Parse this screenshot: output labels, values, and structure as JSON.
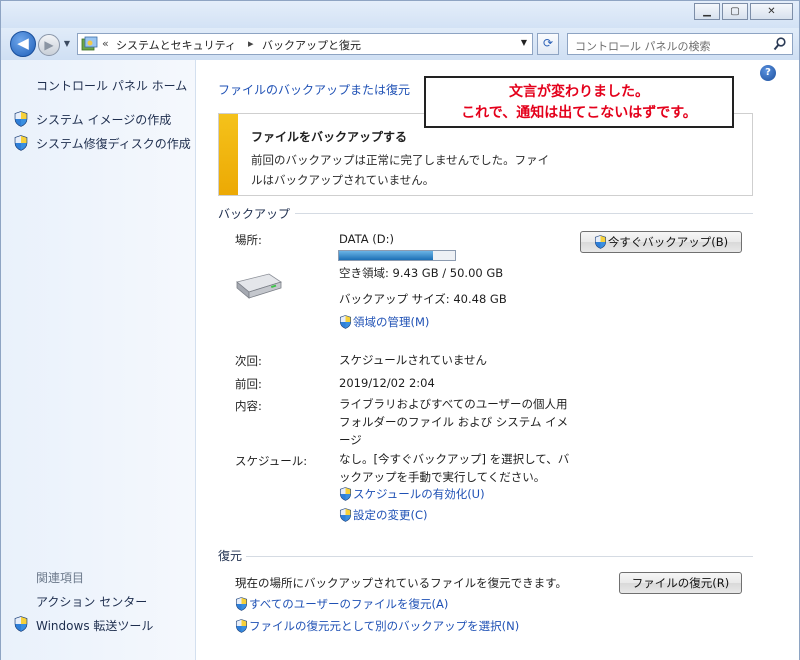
{
  "window": {
    "minimize_glyph": "▁",
    "maximize_glyph": "▢",
    "close_glyph": "✕"
  },
  "nav": {
    "back_glyph": "◀",
    "forward_glyph": "▶",
    "history_glyph": "▼",
    "breadcrumb_prefix": "«",
    "breadcrumb": [
      "システムとセキュリティ",
      "バックアップと復元"
    ],
    "breadcrumb_separator": "▸",
    "address_dropdown_glyph": "▼",
    "refresh_glyph": "⟳",
    "search_placeholder": "コントロール パネルの検索"
  },
  "sidebar": {
    "home": "コントロール パネル ホーム",
    "tasks": [
      "システム イメージの作成",
      "システム修復ディスクの作成"
    ],
    "related_heading": "関連項目",
    "related": [
      "アクション センター",
      "Windows 転送ツール"
    ]
  },
  "main": {
    "help_glyph": "?",
    "title": "ファイルのバックアップまたは復元",
    "callout": {
      "line1": "文言が変わりました。",
      "line2": "これで、通知は出てこないはずです。",
      "color": "#e4001b"
    },
    "notice": {
      "title": "ファイルをバックアップする",
      "body": "前回のバックアップは正常に完了しませんでした。ファイルはバックアップされていません。"
    },
    "backup": {
      "heading": "バックアップ",
      "location_label": "場所:",
      "drive": "DATA (D:)",
      "usage_fraction": 0.811,
      "free_space": "空き領域: 9.43 GB / 50.00 GB",
      "backup_size": "バックアップ サイズ: 40.48 GB",
      "manage_space": "領域の管理(M)",
      "backup_now": "今すぐバックアップ(B)",
      "next_label": "次回:",
      "next_value": "スケジュールされていません",
      "last_label": "前回:",
      "last_value": "2019/12/02 2:04",
      "contents_label": "内容:",
      "contents_value": "ライブラリおよびすべてのユーザーの個人用フォルダーのファイル および システム イメージ",
      "schedule_label": "スケジュール:",
      "schedule_value": "なし。[今すぐバックアップ] を選択して、バックアップを手動で実行してください。",
      "enable_schedule": "スケジュールの有効化(U)",
      "change_settings": "設定の変更(C)"
    },
    "restore": {
      "heading": "復元",
      "description": "現在の場所にバックアップされているファイルを復元できます。",
      "restore_files": "ファイルの復元(R)",
      "restore_all_users": "すべてのユーザーのファイルを復元(A)",
      "select_other": "ファイルの復元元として別のバックアップを選択(N)"
    }
  },
  "colors": {
    "link": "#1f51b5",
    "warning_bar": "#f0b40d",
    "progress": "#1c6fb5"
  }
}
